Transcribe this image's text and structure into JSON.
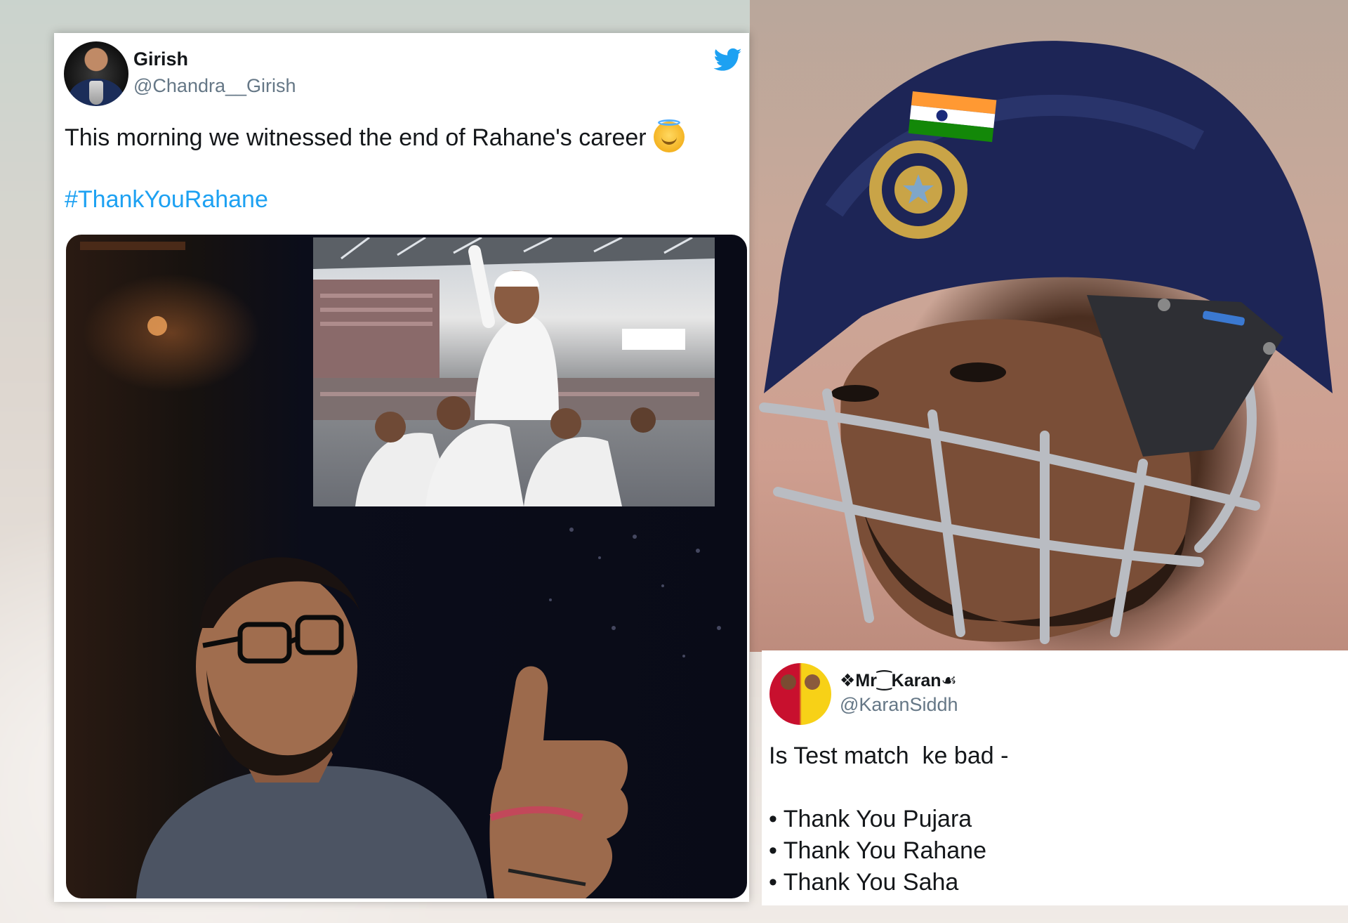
{
  "tweet1": {
    "display_name": "Girish",
    "handle": "@Chandra__Girish",
    "text": "This morning we witnessed the end of Rahane's career",
    "emoji": "innocent-smiling-face",
    "hashtag": "#ThankYouRahane",
    "icon": "twitter-bird-icon",
    "accent_color": "#1da1f2"
  },
  "tweet2": {
    "display_name": "❖Mr⁐Karan☙",
    "handle": "@KaranSiddh",
    "text": "Is Test match  ke bad -",
    "items": [
      "Thank You Pujara",
      "Thank You Rahane",
      "Thank You Saha"
    ]
  },
  "colors": {
    "link": "#1da1f2",
    "secondary_text": "#657786",
    "primary_text": "#14171a"
  }
}
